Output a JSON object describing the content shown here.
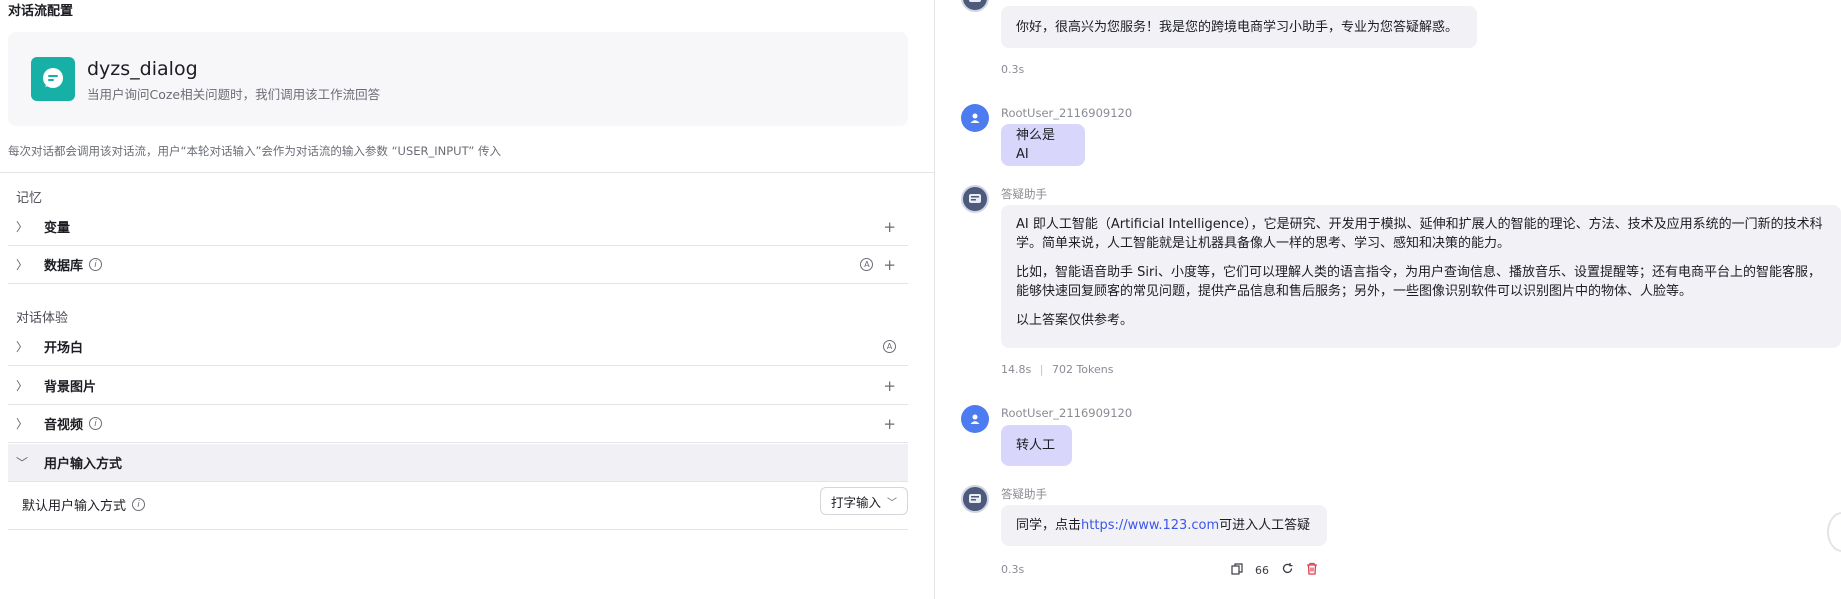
{
  "left": {
    "title": "对话流配置",
    "workflow": {
      "name": "dyzs_dialog",
      "description": "当用户询问Coze相关问题时，我们调用该工作流回答"
    },
    "hint": "每次对话都会调用该对话流，用户“本轮对话输入”会作为对话流的输入参数 “USER_INPUT” 传入",
    "memory_label": "记忆",
    "memory_items": [
      {
        "label": "变量"
      },
      {
        "label": "数据库"
      }
    ],
    "experience_label": "对话体验",
    "experience_items": [
      {
        "label": "开场白"
      },
      {
        "label": "背景图片"
      },
      {
        "label": "音视频"
      },
      {
        "label": "用户输入方式"
      }
    ],
    "default_input_label": "默认用户输入方式",
    "default_input_value": "打字输入"
  },
  "chat": {
    "messages": [
      {
        "role": "bot",
        "text": "你好，很高兴为您服务！我是您的跨境电商学习小助手，专业为您答疑解惑。",
        "meta": "0.3s"
      },
      {
        "role": "user",
        "sender": "RootUser_2116909120",
        "text": "神么是 AI"
      },
      {
        "role": "bot",
        "sender": "答疑助手",
        "paragraphs": [
          "AI 即人工智能（Artificial Intelligence），它是研究、开发用于模拟、延伸和扩展人的智能的理论、方法、技术及应用系统的一门新的技术科学。简单来说，人工智能就是让机器具备像人一样的思考、学习、感知和决策的能力。",
          "比如，智能语音助手 Siri、小度等，它们可以理解人类的语言指令，为用户查询信息、播放音乐、设置提醒等；还有电商平台上的智能客服，能够快速回复顾客的常见问题，提供产品信息和售后服务；另外，一些图像识别软件可以识别图片中的物体、人脸等。",
          "以上答案仅供参考。"
        ],
        "meta": "14.8s",
        "tokens": "702 Tokens"
      },
      {
        "role": "user",
        "sender": "RootUser_2116909120",
        "text": "转人工"
      },
      {
        "role": "bot",
        "sender": "答疑助手",
        "text_before": "同学，点击 ",
        "link": "https://www.123.com",
        "text_after": " 可进入人工答疑",
        "meta": "0.3s",
        "count": "66"
      }
    ]
  }
}
